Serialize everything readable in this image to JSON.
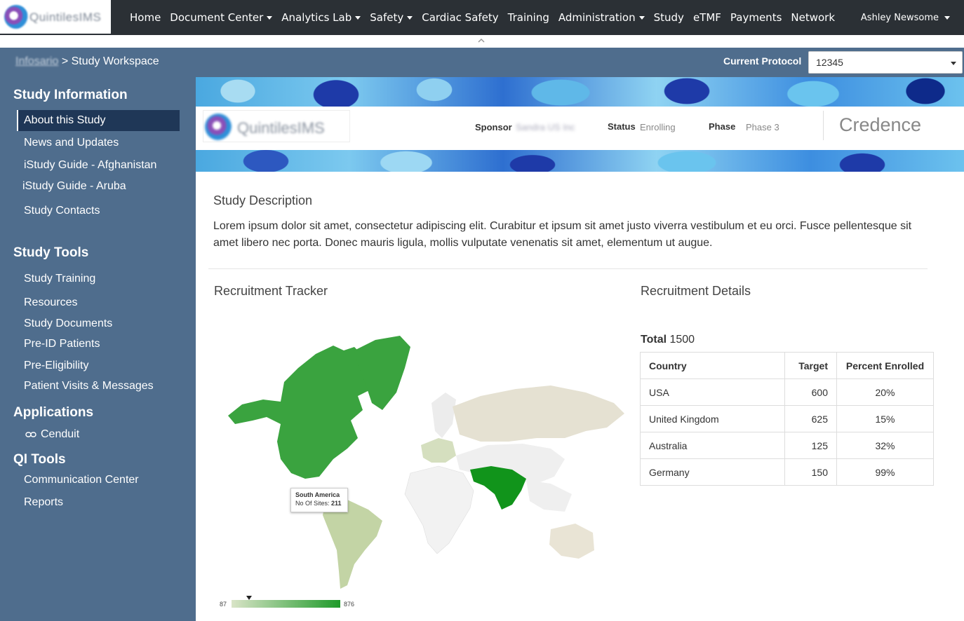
{
  "nav": {
    "logo_text": "QuintilesIMS",
    "items": [
      {
        "label": "Home",
        "dropdown": false
      },
      {
        "label": "Document Center",
        "dropdown": true
      },
      {
        "label": "Analytics Lab",
        "dropdown": true
      },
      {
        "label": "Safety",
        "dropdown": true
      },
      {
        "label": "Cardiac Safety",
        "dropdown": false
      },
      {
        "label": "Training",
        "dropdown": false
      },
      {
        "label": "Administration",
        "dropdown": true
      },
      {
        "label": "Study",
        "dropdown": false
      },
      {
        "label": "eTMF",
        "dropdown": false
      },
      {
        "label": "Payments",
        "dropdown": false
      },
      {
        "label": "Network",
        "dropdown": false
      }
    ],
    "user_name": "Ashley Newsome"
  },
  "subheader": {
    "breadcrumb_link": "Infosario",
    "breadcrumb_sep": " > ",
    "breadcrumb_current": "Study Workspace",
    "protocol_label": "Current Protocol",
    "protocol_value": "12345"
  },
  "sidebar": {
    "study_info_heading": "Study Information",
    "study_info_items": [
      "About this Study",
      "News and Updates",
      "iStudy Guide - Afghanistan",
      "iStudy Guide - Aruba",
      "Study Contacts"
    ],
    "study_tools_heading": "Study Tools",
    "study_tools_items": [
      "Study Training",
      "Resources",
      "Study Documents",
      "Pre-ID Patients",
      "Pre-Eligibility",
      "Patient Visits & Messages"
    ],
    "applications_heading": "Applications",
    "applications_items": [
      "Cenduit"
    ],
    "qi_tools_heading": "QI Tools",
    "qi_tools_items": [
      "Communication Center",
      "Reports"
    ]
  },
  "banner": {
    "logo_text": "QuintilesIMS",
    "sponsor_label": "Sponsor",
    "sponsor_value": "Sandra US Inc",
    "status_label": "Status",
    "status_value": "Enrolling",
    "phase_label": "Phase",
    "phase_value": "Phase 3",
    "study_name": "Credence"
  },
  "description": {
    "title": "Study Description",
    "text": "Lorem ipsum dolor sit amet, consectetur adipiscing elit. Curabitur et ipsum sit amet justo viverra vestibulum et eu orci. Fusce pellentesque sit amet libero nec porta. Donec mauris ligula, mollis vulputate venenatis sit amet, elementum ut augue."
  },
  "tracker": {
    "title": "Recruitment Tracker",
    "tooltip_region": "South America",
    "tooltip_label": "No Of Sites:",
    "tooltip_value": "211",
    "legend_min": "87",
    "legend_max": "876"
  },
  "details": {
    "title": "Recruitment Details",
    "total_label": "Total",
    "total_value": "1500",
    "columns": [
      "Country",
      "Target",
      "Percent Enrolled"
    ],
    "rows": [
      [
        "USA",
        "600",
        "20%"
      ],
      [
        "United Kingdom",
        "625",
        "15%"
      ],
      [
        "Australia",
        "125",
        "32%"
      ],
      [
        "Germany",
        "150",
        "99%"
      ]
    ]
  },
  "colors": {
    "topbar": "#2b3035",
    "sidebar": "#4f6d8d",
    "sidebar_active": "#1f3757",
    "map_high": "#1f9a2a",
    "map_low": "#d9e4c7"
  }
}
